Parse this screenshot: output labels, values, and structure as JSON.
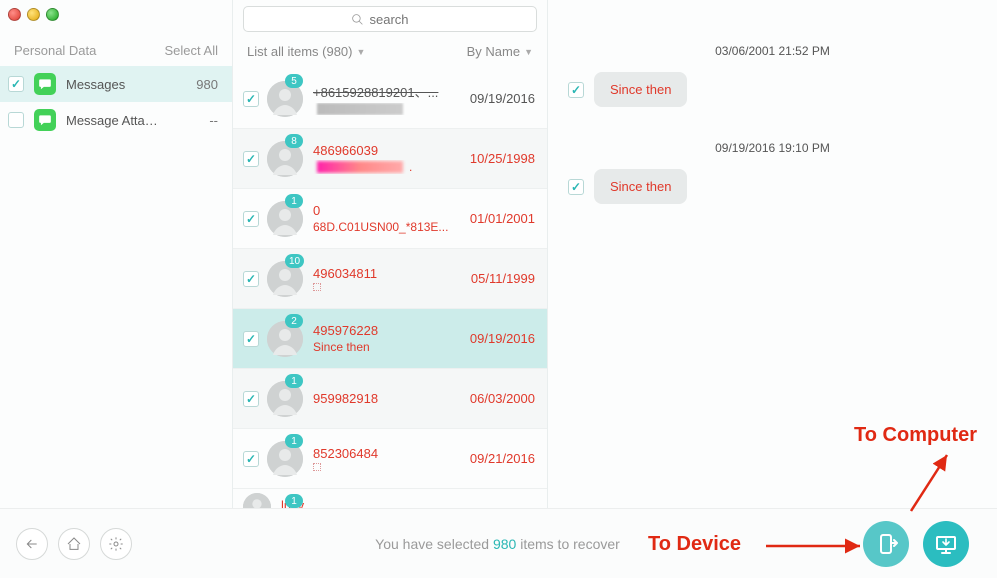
{
  "sidebar": {
    "header": "Personal Data",
    "select_all": "Select All",
    "items": [
      {
        "label": "Messages",
        "count": "980",
        "checked": true
      },
      {
        "label": "Message Atta…",
        "count": "--",
        "checked": false
      }
    ]
  },
  "search": {
    "placeholder": "search"
  },
  "filter": {
    "left": "List all items (980)",
    "right": "By Name"
  },
  "conversations": [
    {
      "badge": "5",
      "title": "+8615928819201、...",
      "title_strike": true,
      "sub_strike": true,
      "date": "09/19/2016",
      "date_dark": true
    },
    {
      "badge": "8",
      "title": "486966039",
      "sub_blur": true,
      "date": "10/25/1998",
      "alt": true
    },
    {
      "badge": "1",
      "title": "0",
      "sub": "68D.C01USN00_*813E...",
      "date": "01/01/2001"
    },
    {
      "badge": "10",
      "title": "496034811",
      "sub_sq": true,
      "date": "05/11/1999",
      "alt": true
    },
    {
      "badge": "2",
      "title": "495976228",
      "sub": "Since then",
      "date": "09/19/2016",
      "selected": true
    },
    {
      "badge": "1",
      "title": "959982918",
      "date": "06/03/2000",
      "alt": true
    },
    {
      "badge": "1",
      "title": "852306484",
      "sub_sq": true,
      "date": "09/21/2016"
    },
    {
      "badge": "1",
      "title": "lucy",
      "partial": true
    }
  ],
  "thread": {
    "ts1": "03/06/2001 21:52 PM",
    "ts2": "09/19/2016 19:10 PM",
    "bubble1": "Since then",
    "bubble2": "Since then"
  },
  "footer": {
    "pre": "You have selected ",
    "count": "980",
    "post": " items to recover"
  },
  "annotations": {
    "to_computer": "To Computer",
    "to_device": "To Device"
  }
}
